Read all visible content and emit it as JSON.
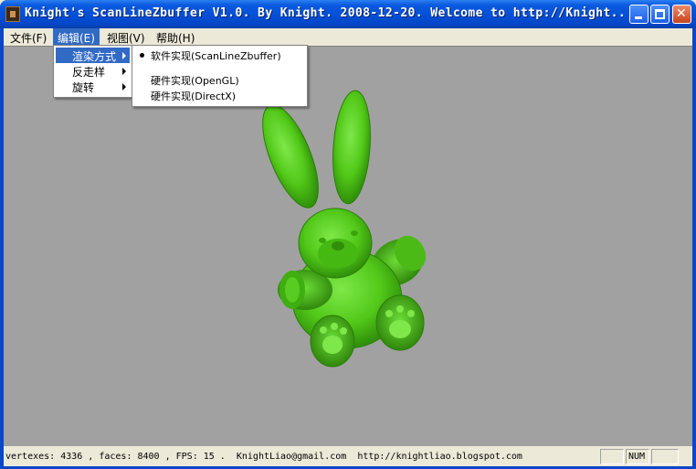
{
  "window": {
    "title": "Knight's ScanLineZbuffer V1.0. By Knight. 2008-12-20.  Welcome to http://Knight...",
    "minimize_label": "_",
    "close_label": "✕"
  },
  "menubar": {
    "items": [
      {
        "label": "文件(F)"
      },
      {
        "label": "编辑(E)"
      },
      {
        "label": "视图(V)"
      },
      {
        "label": "帮助(H)"
      }
    ]
  },
  "edit_menu": {
    "items": [
      {
        "label": "渲染方式"
      },
      {
        "label": "反走样"
      },
      {
        "label": "旋转"
      }
    ]
  },
  "render_submenu": {
    "items": [
      {
        "label": "软件实现(ScanLineZbuffer)",
        "checked": true
      },
      {
        "label": "硬件实现(OpenGL)",
        "checked": false
      },
      {
        "label": "硬件实现(DirectX)",
        "checked": false
      }
    ]
  },
  "statusbar": {
    "info": "vertexes: 4336 , faces: 8400 , FPS: 15 .  KnightLiao@gmail.com  http://knightliao.blogspot.com",
    "num_indicator": "NUM"
  },
  "colors": {
    "titlebar": "#0550d8",
    "menu_highlight": "#316ac5",
    "canvas_bg": "#a1a1a1",
    "model_green": "#5ad41e"
  }
}
